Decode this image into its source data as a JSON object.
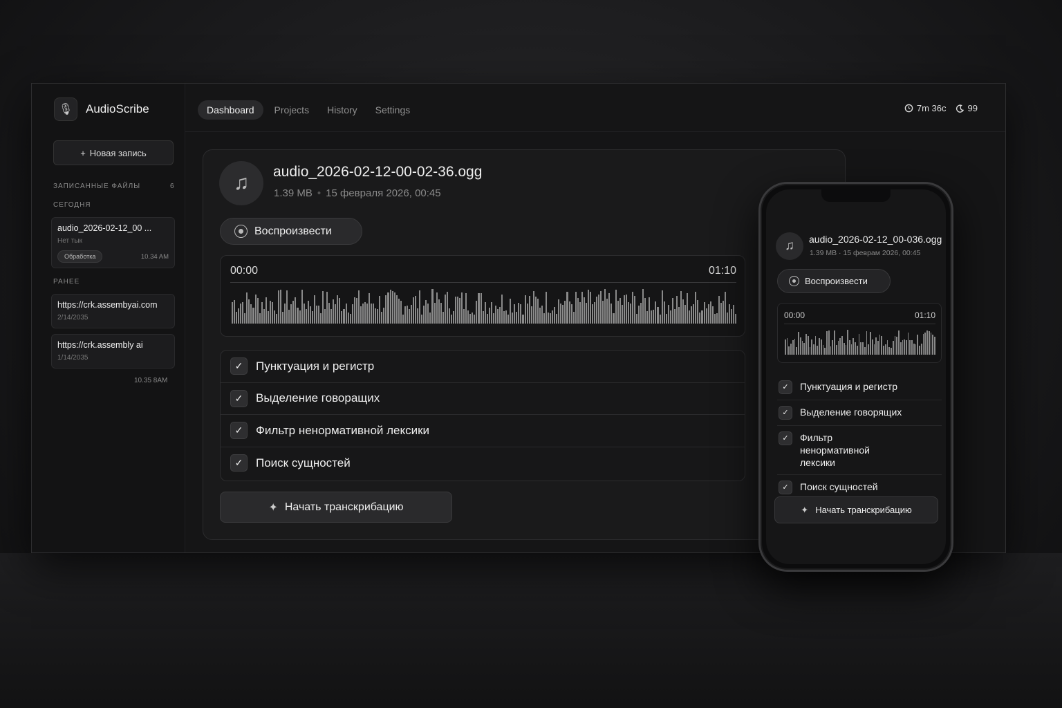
{
  "app": {
    "name": "AudioScribe"
  },
  "nav": {
    "tabs": [
      "Dashboard",
      "Projects",
      "History",
      "Settings"
    ],
    "active": "Dashboard"
  },
  "stats": {
    "time": "7m 36c",
    "count": "99"
  },
  "sidebar": {
    "new_button": "Новая запись",
    "section_title": "Записанные файлы",
    "count": "6",
    "today_label": "Сегодня",
    "earlier_label": "Ранее",
    "today_file": {
      "name": "audio_2026-02-12_00 ...",
      "sub": "Нет тык",
      "badge": "Обработка",
      "time": "10.34 AM"
    },
    "earlier_files": [
      {
        "name": "https://crk.assembyai.com",
        "date": "2/14/2035"
      },
      {
        "name": "https://crk.assembly ai",
        "date": "1/14/2035"
      }
    ],
    "bottom_time": "10.35 8AM"
  },
  "main": {
    "file_title": "audio_2026-02-12-00-02-36.ogg",
    "size": "1.39 MB",
    "date": "15 февраля 2026, 00:45",
    "play_label": "Воспроизвести",
    "wave_start": "00:00",
    "wave_end": "01:10",
    "options": [
      "Пунктуация и регистр",
      "Выделение говоращих",
      "Фильтр ненормативной лексики",
      "Поиск сущностей"
    ],
    "start_label": "Начать транскрибацию"
  },
  "phone": {
    "file_title": "audio_2026-02-12_00-036.ogg",
    "meta": "1.39 MB · 15 феврам 2026, 00:45",
    "play_label": "Воспроизвести",
    "wave_start": "00:00",
    "wave_end": "01:10",
    "options": [
      "Пунктуация и регистр",
      "Выделение говорящих",
      "Фильтр ненормативной лексики",
      "Поиск сущностей"
    ],
    "start_label": "Начать транскрибацию"
  },
  "colors": {
    "background": "#1b1b1d",
    "card": "#1a1a1b",
    "accent": "#2a2a2c",
    "text": "#e6e6e6"
  }
}
